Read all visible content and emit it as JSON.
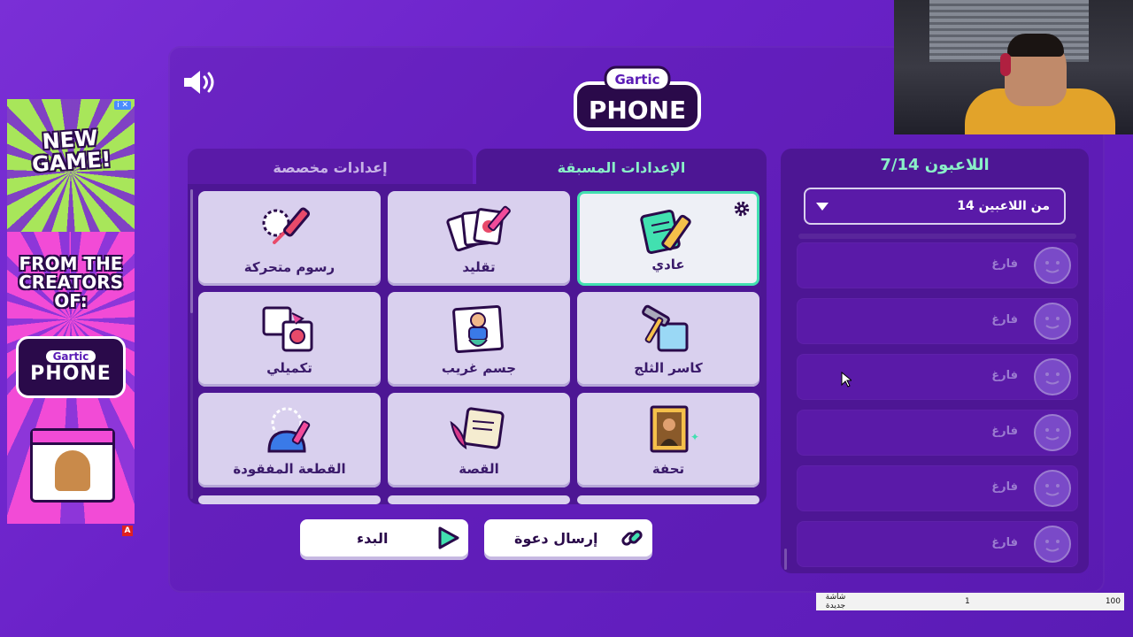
{
  "ad": {
    "headline": "NEW GAME!",
    "subline": "FROM THE CREATORS OF:",
    "brand_top": "Gartic",
    "brand_bottom": "PHONE",
    "info_badge": "i ✕",
    "corner_badge": "A"
  },
  "logo": {
    "top": "Gartic",
    "bottom": "PHONE"
  },
  "tabs": {
    "custom": "إعدادات مخصصة",
    "preset": "الإعدادات المسبقة"
  },
  "modes": [
    {
      "label": "عادي",
      "icon": "notebook-pencil-icon",
      "selected": true
    },
    {
      "label": "تقليد",
      "icon": "cards-icon"
    },
    {
      "label": "رسوم متحركة",
      "icon": "animation-icon"
    },
    {
      "label": "كاسر الثلج",
      "icon": "ice-breaker-icon"
    },
    {
      "label": "جسم غريب",
      "icon": "strange-body-icon"
    },
    {
      "label": "تكميلي",
      "icon": "puzzle-icon"
    },
    {
      "label": "تحفة",
      "icon": "masterpiece-icon"
    },
    {
      "label": "القصة",
      "icon": "story-scroll-icon"
    },
    {
      "label": "القطعة المفقودة",
      "icon": "missing-piece-icon"
    }
  ],
  "buttons": {
    "start": "البدء",
    "invite": "إرسال دعوة"
  },
  "players": {
    "title": "اللاعبون 7/14",
    "select_value": "14 من اللاعبين",
    "slots": [
      "فارغ",
      "فارغ",
      "فارغ",
      "فارغ",
      "فارغ",
      "فارغ"
    ]
  },
  "overlay": {
    "left": "شاشة جديدة",
    "mid": "1",
    "right": "100"
  },
  "colors": {
    "accent": "#42e0b0",
    "panel": "#4d1694",
    "card": "#d9d0ee"
  }
}
